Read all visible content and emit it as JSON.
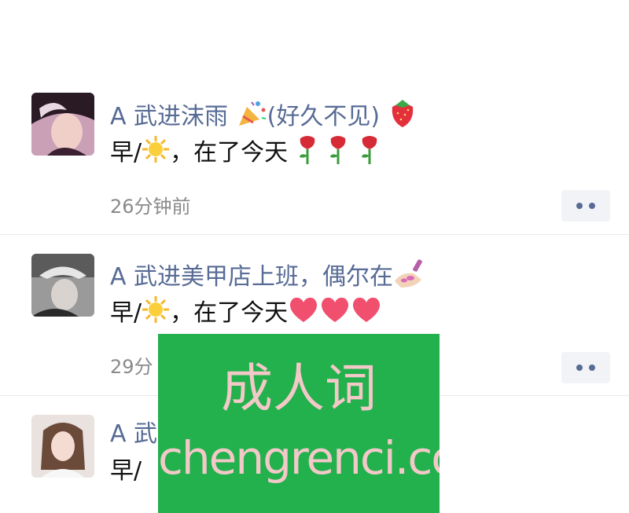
{
  "posts": [
    {
      "name": "A 武进沫雨",
      "name_suffix": "(好久不见)",
      "text_prefix": "早/",
      "text_mid": "，在了今天",
      "time": "26分钟前"
    },
    {
      "name": "A 武进美甲店上班，偶尔在",
      "text_prefix": "早/",
      "text_mid": "，在了今天",
      "time": "29分"
    },
    {
      "name": "A 武",
      "text_prefix": "早/"
    }
  ],
  "icons": {
    "party": "party-popper-icon",
    "strawberry": "strawberry-icon",
    "sun": "sun-icon",
    "rose": "rose-icon",
    "heart": "heart-icon",
    "nail": "nail-polish-icon",
    "more": "more-dots-icon"
  },
  "colors": {
    "name": "#576b95",
    "text": "#111111",
    "time": "#8a8a8a",
    "more_bg": "#f1f3f6",
    "watermark_bg": "#22b14c",
    "watermark_text": "#f3c8c8",
    "heart": "#f0506e"
  },
  "watermark": {
    "title": "成人词",
    "url": "chengrenci.com"
  }
}
